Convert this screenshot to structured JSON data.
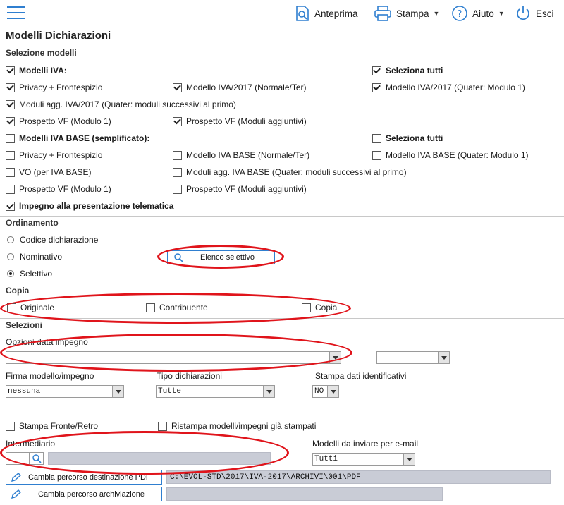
{
  "toolbar": {
    "anteprima": "Anteprima",
    "stampa": "Stampa",
    "aiuto": "Aiuto",
    "esci": "Esci"
  },
  "page_title": "Modelli Dichiarazioni",
  "selezione_modelli": {
    "section_label": "Selezione modelli",
    "iva": {
      "group_label": "Modelli IVA:",
      "select_all": "Seleziona tutti",
      "items": [
        "Privacy + Frontespizio",
        "Modello IVA/2017 (Normale/Ter)",
        "Modello IVA/2017 (Quater: Modulo 1)",
        "Moduli agg. IVA/2017 (Quater: moduli successivi al primo)",
        "Prospetto VF (Modulo 1)",
        "Prospetto VF (Moduli aggiuntivi)"
      ]
    },
    "iva_base": {
      "group_label": "Modelli IVA BASE (semplificato):",
      "select_all": "Seleziona tutti",
      "items": [
        "Privacy + Frontespizio",
        "Modello IVA BASE (Normale/Ter)",
        "Modello IVA BASE (Quater: Modulo 1)",
        "VO (per IVA BASE)",
        "Moduli agg. IVA BASE (Quater: moduli successivi al primo)",
        "Prospetto VF (Modulo 1)",
        "Prospetto VF (Moduli aggiuntivi)"
      ]
    },
    "impegno": "Impegno alla presentazione telematica"
  },
  "ordinamento": {
    "section_label": "Ordinamento",
    "options": [
      "Codice dichiarazione",
      "Nominativo",
      "Selettivo"
    ],
    "selected": "Selettivo",
    "elenco_button": "Elenco selettivo"
  },
  "copia": {
    "section_label": "Copia",
    "options": [
      "Originale",
      "Contribuente",
      "Copia"
    ]
  },
  "selezioni": {
    "section_label": "Selezioni",
    "opzioni_data_label": "Opzioni data impegno",
    "firma_label": "Firma modello/impegno",
    "firma_value": "nessuna",
    "tipo_label": "Tipo dichiarazioni",
    "tipo_value": "Tutte",
    "stampa_dati_label": "Stampa dati identificativi",
    "stampa_dati_value": "NO",
    "fronte_retro": "Stampa Fronte/Retro",
    "ristampa": "Ristampa modelli/impegni già stampati",
    "intermediario_label": "Intermediario",
    "modelli_email_label": "Modelli da inviare per e-mail",
    "modelli_email_value": "Tutti",
    "pdf_button": "Cambia percorso destinazione PDF",
    "pdf_path": "C:\\EVOL-STD\\2017\\IVA-2017\\ARCHIVI\\001\\PDF",
    "archiviazione_button": "Cambia percorso archiviazione",
    "archiviazione_path": ""
  },
  "colors": {
    "accent": "#2f7fd0",
    "annotation": "#e0141b",
    "readonly_field": "#c9ccd6"
  }
}
